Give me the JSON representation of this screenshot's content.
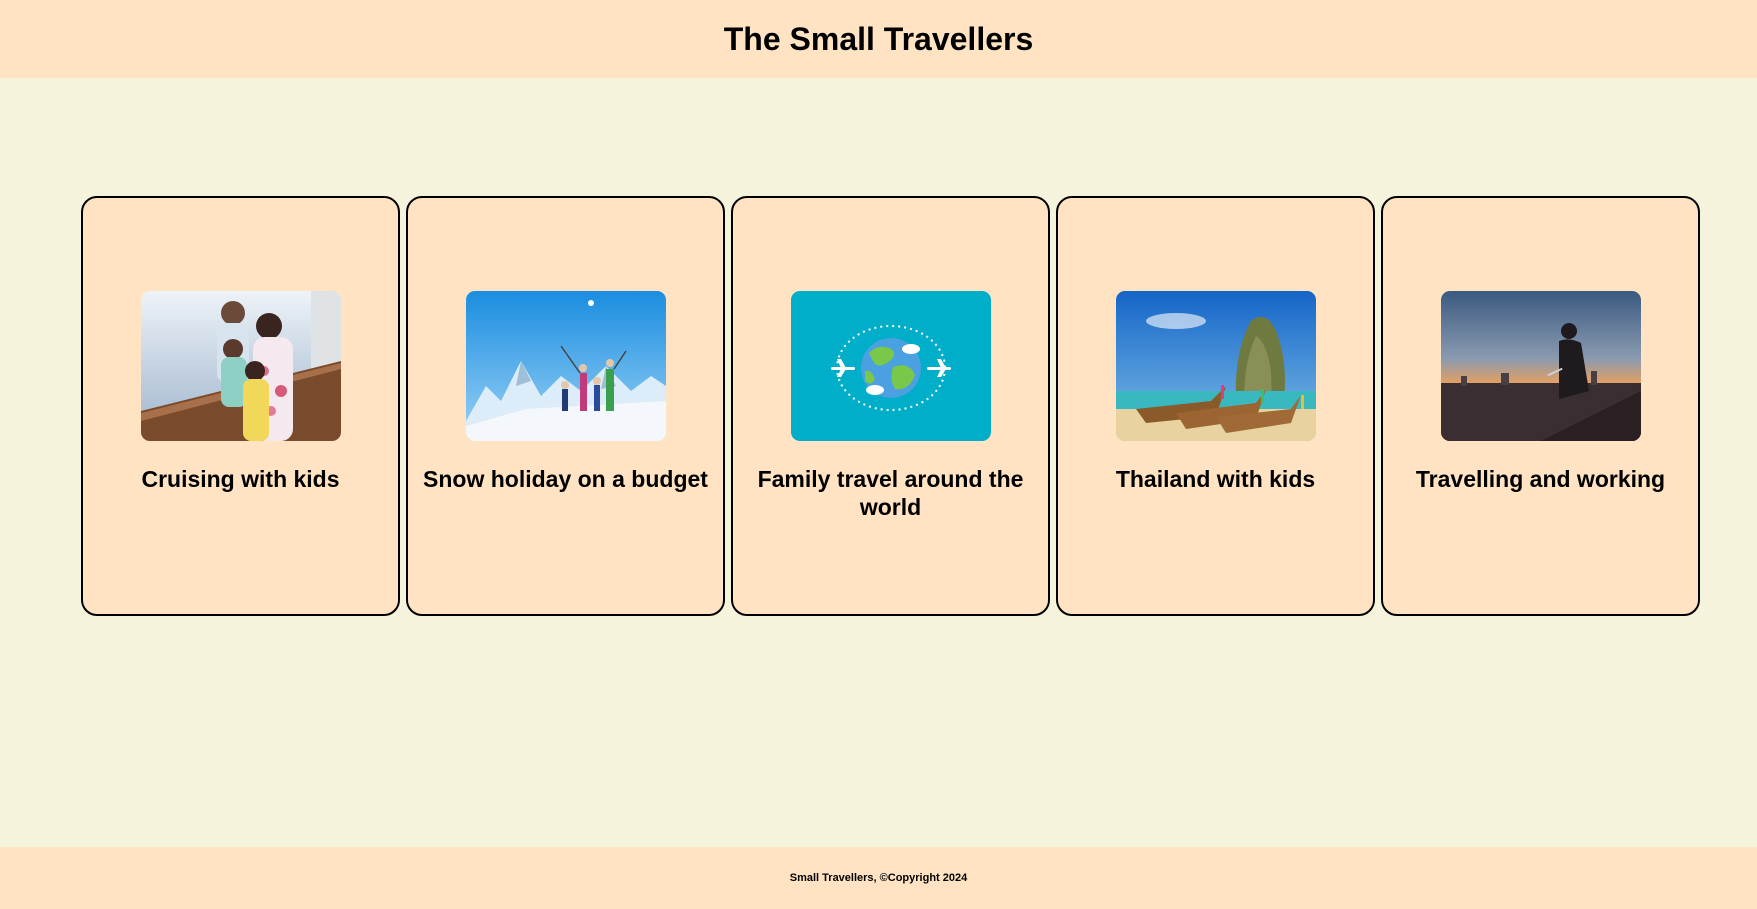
{
  "header": {
    "title": "The Small Travellers"
  },
  "cards": [
    {
      "title": "Cruising with kids",
      "image": "family-on-cruise-deck-photo"
    },
    {
      "title": "Snow holiday on a budget",
      "image": "skiers-on-mountain-photo"
    },
    {
      "title": "Family travel around the world",
      "image": "globe-with-planes-illustration"
    },
    {
      "title": "Thailand with kids",
      "image": "longtail-boats-beach-photo"
    },
    {
      "title": "Travelling and working",
      "image": "person-with-laptop-city-sunset-photo"
    }
  ],
  "footer": {
    "text": "Small Travellers, ©Copyright 2024"
  },
  "colors": {
    "background": "#f5f3dc",
    "header_footer": "#ffe3c2",
    "card": "#ffe3c2",
    "border": "#000000",
    "globe_tile": "#00aec9"
  }
}
